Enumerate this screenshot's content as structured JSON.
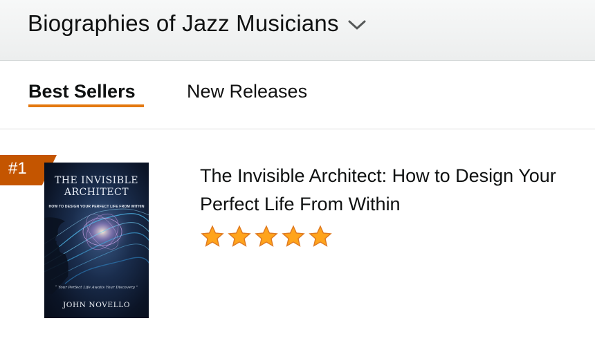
{
  "header": {
    "category_title": "Biographies of Jazz Musicians",
    "chevron_icon": "chevron-down-icon"
  },
  "tabs": [
    {
      "label": "Best Sellers",
      "active": true
    },
    {
      "label": "New Releases",
      "active": false
    }
  ],
  "products": [
    {
      "rank": "#1",
      "title": "The Invisible Architect: How to Design Your Perfect Life From Within",
      "rating": 5,
      "rating_max": 5,
      "cover": {
        "title_line1": "THE INVISIBLE",
        "title_line2": "ARCHITECT",
        "subtitle": "HOW TO DESIGN YOUR PERFECT LIFE FROM WITHIN",
        "quote": "“ Your Perfect Life Awaits Your Discovery ”",
        "author": "JOHN NOVELLO"
      }
    }
  ],
  "colors": {
    "accent_underline": "#e47911",
    "rank_badge": "#c45500",
    "star_fill": "#ffa41c"
  }
}
